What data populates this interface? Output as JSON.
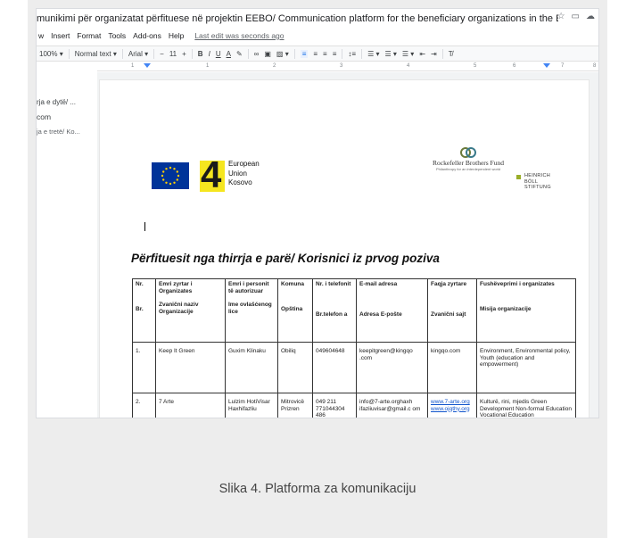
{
  "window": {
    "title": "munikimi për organizatat përfituese në projektin EEBO/ Communication platform for the beneficiary organizations in the EEBO project",
    "icons": [
      "star-icon",
      "folder-icon",
      "cloud-icon"
    ]
  },
  "menu": {
    "items": [
      "w",
      "Insert",
      "Format",
      "Tools",
      "Add-ons",
      "Help"
    ],
    "last_edit": "Last edit was seconds ago"
  },
  "toolbar": {
    "zoom": "100%",
    "style": "Normal text",
    "font": "Arial",
    "font_size": "11",
    "minus": "−",
    "plus": "+",
    "bold": "B",
    "italic": "I",
    "underline": "U",
    "text_color": "A"
  },
  "ruler": {
    "ticks": [
      "1",
      "1",
      "2",
      "3",
      "4",
      "5",
      "6",
      "7",
      "8"
    ]
  },
  "outline": {
    "items": [
      "rja e dytë/ ...",
      "com",
      "ja e tretë/ Ko..."
    ]
  },
  "document": {
    "logos": {
      "eu_kosovo": [
        "European",
        "Union",
        "Kosovo"
      ],
      "rbf_name": "Rockefeller Brothers Fund",
      "rbf_tag": "Philanthropy for an interdependent world",
      "hbs": [
        "HEINRICH",
        "BÖLL",
        "STIFTUNG"
      ]
    },
    "heading": "Përfituesit nga thirrja e parë/ Korisnici iz prvog poziva",
    "table": {
      "headers": [
        {
          "top": "Nr.",
          "bottom": "Br."
        },
        {
          "top": "Emri zyrtar i Organizates",
          "bottom": "Zvanični naziv Organizacije"
        },
        {
          "top": "Emri i personit të autorizuar",
          "bottom": "Ime ovlašćenog lice"
        },
        {
          "top": "Komuna",
          "bottom": "Opština"
        },
        {
          "top": "Nr. i telefonit",
          "bottom": "Br.telefon a"
        },
        {
          "top": "E-mail adresa",
          "bottom": "Adresa E-pošte"
        },
        {
          "top": "Faqja zyrtare",
          "bottom": "Zvanični sajt"
        },
        {
          "top": "Fushëveprimi i organizates",
          "bottom": "Misija organizacije"
        }
      ],
      "rows": [
        [
          "1.",
          "Keep It Green",
          "Guxim Klinaku",
          "Obiliq",
          "049604648",
          "keepitgreen@kingqo .com",
          "kingqo.com",
          "Environment, Environmental policy, Youth (education and empowerment)"
        ],
        [
          "2.",
          "7 Arte",
          "Lulzim HotiVisar Haxhifazliu",
          "Mitrovicë Prizren",
          "049 211 771044304 486",
          "info@7-arte.orghaxh ifaziiuvisar@gmail.c om",
          "www.7-arte.org www.ojqthy.org",
          "Kulturë, rini, mjedis Green Development Non-formal Education Vocational Education"
        ]
      ]
    }
  },
  "caption": "Slika 4. Platforma za komunikaciju"
}
